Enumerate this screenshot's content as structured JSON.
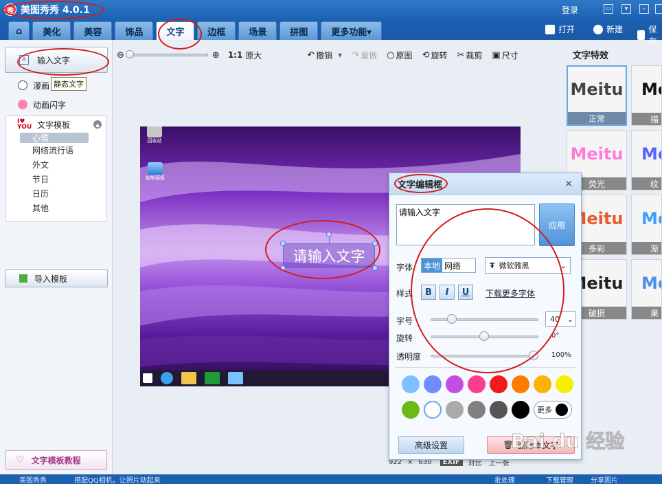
{
  "app": {
    "title": "美图秀秀 4.0.1",
    "logo_char": "秀",
    "login": "登录"
  },
  "tabs": [
    {
      "label": "美化"
    },
    {
      "label": "美容"
    },
    {
      "label": "饰品"
    },
    {
      "label": "文字"
    },
    {
      "label": "边框"
    },
    {
      "label": "场景"
    },
    {
      "label": "拼图"
    },
    {
      "label": "更多功能▾"
    }
  ],
  "top_actions": {
    "open": "打开",
    "new": "新建",
    "save": "保存"
  },
  "left": {
    "input_text": "输入文字",
    "comic": "漫画",
    "tooltip": "静态文字",
    "animated": "动画闪字",
    "template_heading": "文字模板",
    "template_items": [
      "心情",
      "网络流行语",
      "外文",
      "节日",
      "日历",
      "其他"
    ],
    "import_template": "导入模板",
    "tutorial": "文字模板教程"
  },
  "toolbar": {
    "zoom_original": "原大",
    "one_to_one": "1:1",
    "undo": "撤销",
    "redo": "重做",
    "original": "原图",
    "rotate": "旋转",
    "crop": "裁剪",
    "size": "尺寸"
  },
  "canvas": {
    "overlay_text": "请输入文字",
    "desktop_icons": [
      "回收站",
      "控制面板"
    ],
    "image_width": "922",
    "image_times": "×",
    "image_height": "630",
    "exif": "EXIF",
    "compare": "对比",
    "prev": "上一张"
  },
  "effects": {
    "heading": "文字特效",
    "items": [
      {
        "preview": "Meitu",
        "label": "正常",
        "color": "#444444"
      },
      {
        "preview": "Me",
        "label": "描",
        "color": "#111111"
      },
      {
        "preview": "Meitu",
        "label": "荧光",
        "color": "#ff7ad8"
      },
      {
        "preview": "Me",
        "label": "纹",
        "color": "#5566ff"
      },
      {
        "preview": "Meitu",
        "label": "多彩",
        "color": "#e85a2c"
      },
      {
        "preview": "Me",
        "label": "渐",
        "color": "#3da0ff"
      },
      {
        "preview": "Meitu",
        "label": "破损",
        "color": "#222222"
      },
      {
        "preview": "Me",
        "label": "果",
        "color": "#4a8fe8"
      }
    ]
  },
  "dialog": {
    "title": "文字编辑框",
    "text_value": "请输入文字",
    "apply": "应用",
    "font_label": "字体",
    "font_local": "本地",
    "font_web": "网络",
    "font_name": "微软雅黑",
    "style_label": "样式",
    "bold": "B",
    "italic": "I",
    "underline": "U",
    "download_fonts": "下载更多字体",
    "size_label": "字号",
    "size_value": "40",
    "rotate_label": "旋转",
    "rotate_value": "0°",
    "opacity_label": "透明度",
    "opacity_value": "100%",
    "more_colors": "更多",
    "advanced": "高级设置",
    "delete_text": "删除本文字",
    "colors": [
      "#7ec0ff",
      "#6f8dff",
      "#c34ee6",
      "#ff3c8d",
      "#f21a1a",
      "#ff7a00",
      "#ffb300",
      "#f5f000",
      "#6aba1a",
      "#ffffff",
      "#aaaaaa",
      "#808080",
      "#555555",
      "#000000"
    ]
  },
  "status": {
    "left": "美图秀秀",
    "mid": "搭配QQ相机，让照片动起来",
    "batch": "批处理",
    "download": "下载管理",
    "share": "分享图片"
  },
  "watermark": "Bai du 经验"
}
